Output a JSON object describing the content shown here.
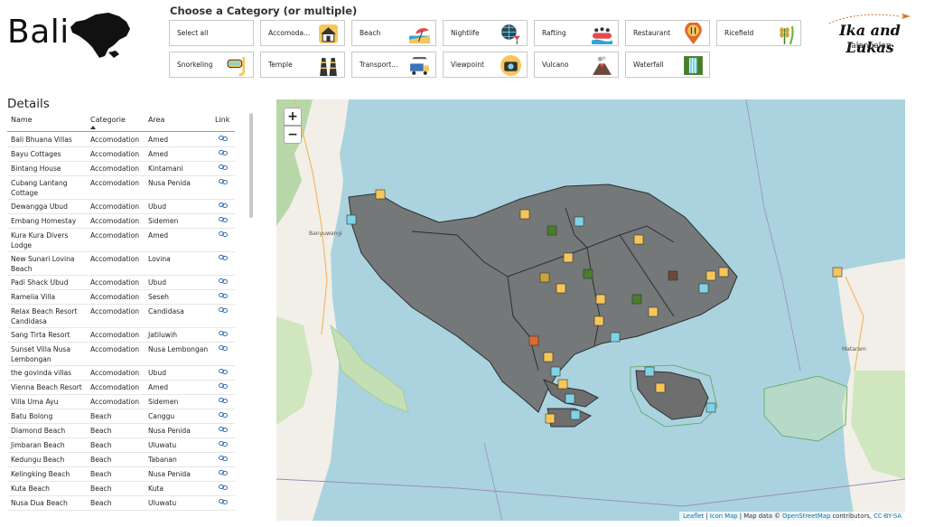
{
  "header": {
    "title": "Bali"
  },
  "categories": {
    "title": "Choose a Category (or multiple)",
    "buttons": [
      {
        "label": "Select all",
        "icon": "none"
      },
      {
        "label": "Accomoda...",
        "icon": "house-icon"
      },
      {
        "label": "Beach",
        "icon": "beach-umbrella-icon"
      },
      {
        "label": "Nightlife",
        "icon": "disco-ball-icon"
      },
      {
        "label": "Rafting",
        "icon": "raft-icon"
      },
      {
        "label": "Restaurant",
        "icon": "fork-knife-pin-icon"
      },
      {
        "label": "Ricefield",
        "icon": "rice-plant-icon"
      },
      {
        "label": "Snorkeling",
        "icon": "snorkel-mask-icon"
      },
      {
        "label": "Temple",
        "icon": "temple-icon"
      },
      {
        "label": "Transport...",
        "icon": "truck-plane-icon"
      },
      {
        "label": "Viewpoint",
        "icon": "camera-icon"
      },
      {
        "label": "Vulcano",
        "icon": "volcano-icon"
      },
      {
        "label": "Waterfall",
        "icon": "waterfall-icon"
      }
    ]
  },
  "logo": {
    "name": "Ika and Lukas",
    "sub": "Jalan-jalan"
  },
  "details": {
    "title": "Details",
    "columns": {
      "name": "Name",
      "category": "Categorie",
      "area": "Area",
      "link": "Link"
    },
    "rows": [
      {
        "name": "Bali Bhuana Villas",
        "category": "Accomodation",
        "area": "Amed"
      },
      {
        "name": "Bayu Cottages",
        "category": "Accomodation",
        "area": "Amed"
      },
      {
        "name": "Bintang House",
        "category": "Accomodation",
        "area": "Kintamani"
      },
      {
        "name": "Cubang Lantang Cottage",
        "category": "Accomodation",
        "area": "Nusa Penida"
      },
      {
        "name": "Dewangga Ubud",
        "category": "Accomodation",
        "area": "Ubud"
      },
      {
        "name": "Embang Homestay",
        "category": "Accomodation",
        "area": "Sidemen"
      },
      {
        "name": "Kura Kura Divers Lodge",
        "category": "Accomodation",
        "area": "Amed"
      },
      {
        "name": "New Sunari Lovina Beach",
        "category": "Accomodation",
        "area": "Lovina"
      },
      {
        "name": "Padi Shack Ubud",
        "category": "Accomodation",
        "area": "Ubud"
      },
      {
        "name": "Ramelia Villa",
        "category": "Accomodation",
        "area": "Seseh"
      },
      {
        "name": "Relax Beach Resort Candidasa",
        "category": "Accomodation",
        "area": "Candidasa"
      },
      {
        "name": "Sang Tirta Resort",
        "category": "Accomodation",
        "area": "Jatiluwih"
      },
      {
        "name": "Sunset Villa Nusa Lembongan",
        "category": "Accomodation",
        "area": "Nusa Lembongan"
      },
      {
        "name": "the govinda villas",
        "category": "Accomodation",
        "area": "Ubud"
      },
      {
        "name": "Vienna Beach Resort",
        "category": "Accomodation",
        "area": "Amed"
      },
      {
        "name": "Villa Uma Ayu",
        "category": "Accomodation",
        "area": "Sidemen"
      },
      {
        "name": "Batu Bolong",
        "category": "Beach",
        "area": "Canggu"
      },
      {
        "name": "Diamond Beach",
        "category": "Beach",
        "area": "Nusa Penida"
      },
      {
        "name": "Jimbaran Beach",
        "category": "Beach",
        "area": "Uluwatu"
      },
      {
        "name": "Kedungu Beach",
        "category": "Beach",
        "area": "Tabanan"
      },
      {
        "name": "Kelingking Beach",
        "category": "Beach",
        "area": "Nusa Penida"
      },
      {
        "name": "Kuta Beach",
        "category": "Beach",
        "area": "Kuta"
      },
      {
        "name": "Nusa Dua Beach",
        "category": "Beach",
        "area": "Uluwatu"
      }
    ]
  },
  "map": {
    "zoom_in": "+",
    "zoom_out": "−",
    "labels": [
      "Banyuwangi",
      "Mataram"
    ],
    "attribution": {
      "leaflet": "Leaflet",
      "sep1": " | ",
      "iconmap": "Icon Map",
      "mid": " | Map data © ",
      "osm": "OpenStreetMap",
      "contrib": " contributors, ",
      "license": "CC-BY-SA"
    }
  },
  "colors": {
    "accent": "#f2c14e",
    "region_fill": "#6e6e6e",
    "water": "#aad3df",
    "land": "#f2efe9"
  }
}
